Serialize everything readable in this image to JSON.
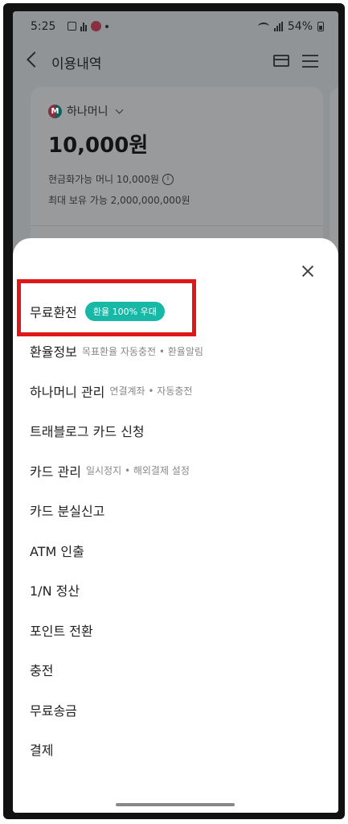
{
  "status_bar": {
    "time": "5:25",
    "battery": "54%"
  },
  "header": {
    "title": "이용내역"
  },
  "background_card": {
    "wallet_name": "하나머니",
    "logo_letter": "M",
    "balance": "10,000원",
    "convertible_label": "현금화가능 머니 10,000원",
    "max_hold_label": "최대 보유 가능 2,000,000,000원"
  },
  "sheet": {
    "items": [
      {
        "title": "무료환전",
        "badge": "환율 100% 우대"
      },
      {
        "title": "환율정보",
        "sub": "목표환율 자동충전 • 환율알림"
      },
      {
        "title": "하나머니 관리",
        "sub": "연결계좌 • 자동충전"
      },
      {
        "title": "트래블로그 카드 신청"
      },
      {
        "title": "카드 관리",
        "sub": "일시정지 • 해외결제 설정"
      },
      {
        "title": "카드 분실신고"
      },
      {
        "title": "ATM 인출"
      },
      {
        "title": "1/N 정산"
      },
      {
        "title": "포인트 전환"
      },
      {
        "title": "충전"
      },
      {
        "title": "무료송금"
      },
      {
        "title": "결제"
      }
    ]
  },
  "colors": {
    "accent": "#17b8a6",
    "highlight": "#e01717"
  },
  "icons": [
    "back-icon",
    "card-icon",
    "menu-icon",
    "close-icon",
    "info-icon",
    "chevron-down-icon",
    "hana-logo-icon"
  ]
}
